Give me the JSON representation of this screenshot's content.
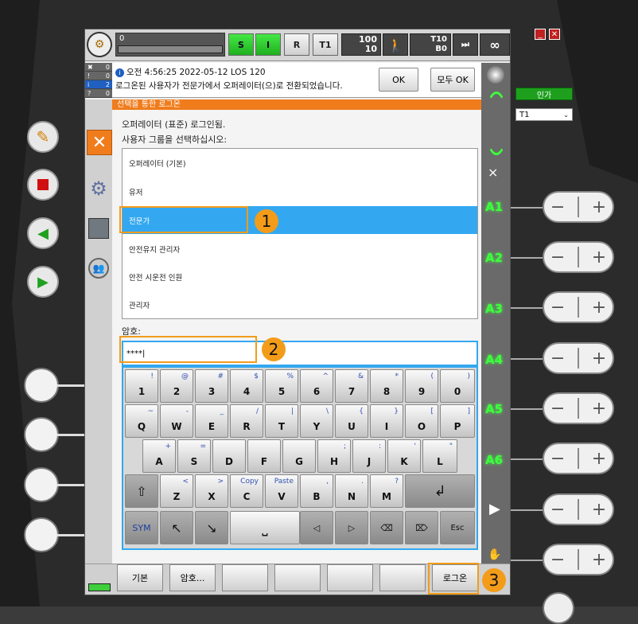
{
  "topbar": {
    "progress_value": "0",
    "btn_s": "S",
    "btn_i": "I",
    "btn_r": "R",
    "btn_t1": "T1",
    "override_top": "100",
    "override_bottom": "10",
    "tool_top": "T10",
    "tool_bottom": "B0",
    "infinity": "∞"
  },
  "message": {
    "counts": [
      "0",
      "0",
      "2",
      "0"
    ],
    "header": "오전 4:56:25 2022-05-12 LOS 120",
    "text": "로그온된 사용자가 전문가에서 오퍼레이터(으)로 전환되었습니다.",
    "ok_label": "OK",
    "all_ok_label": "모두 OK"
  },
  "login": {
    "bar_title": "선택을 통한 로그온",
    "current_user": "오퍼레이터 (표준) 로그인됨.",
    "instruction": "사용자 그룹을 선택하십시오:",
    "groups": [
      "오퍼레이터 (기본)",
      "유저",
      "전문가",
      "안전유지 관리자",
      "안전 시운전 인원",
      "관리자"
    ],
    "password_label": "암호:",
    "password_value": "****|"
  },
  "keyboard": {
    "row1": [
      {
        "k": "1",
        "a": "!"
      },
      {
        "k": "2",
        "a": "@"
      },
      {
        "k": "3",
        "a": "#"
      },
      {
        "k": "4",
        "a": "$"
      },
      {
        "k": "5",
        "a": "%"
      },
      {
        "k": "6",
        "a": "^"
      },
      {
        "k": "7",
        "a": "&"
      },
      {
        "k": "8",
        "a": "*"
      },
      {
        "k": "9",
        "a": "("
      },
      {
        "k": "0",
        "a": ")"
      }
    ],
    "row2": [
      {
        "k": "Q",
        "a": "~"
      },
      {
        "k": "W",
        "a": "-"
      },
      {
        "k": "E",
        "a": "_"
      },
      {
        "k": "R",
        "a": "/"
      },
      {
        "k": "T",
        "a": "|"
      },
      {
        "k": "Y",
        "a": "\\"
      },
      {
        "k": "U",
        "a": "{"
      },
      {
        "k": "I",
        "a": "}"
      },
      {
        "k": "O",
        "a": "["
      },
      {
        "k": "P",
        "a": "]"
      }
    ],
    "row3": [
      {
        "k": "A",
        "a": "+"
      },
      {
        "k": "S",
        "a": "="
      },
      {
        "k": "D",
        "a": ""
      },
      {
        "k": "F",
        "a": ""
      },
      {
        "k": "G",
        "a": ""
      },
      {
        "k": "H",
        "a": ";"
      },
      {
        "k": "J",
        "a": ":"
      },
      {
        "k": "K",
        "a": "'"
      },
      {
        "k": "L",
        "a": "\""
      }
    ],
    "row4": [
      {
        "k": "Z",
        "a": "<"
      },
      {
        "k": "X",
        "a": ">"
      },
      {
        "k": "C",
        "a": "Copy"
      },
      {
        "k": "V",
        "a": "Paste"
      },
      {
        "k": "B",
        "a": ","
      },
      {
        "k": "N",
        "a": "."
      },
      {
        "k": "M",
        "a": "?"
      }
    ],
    "shift": "⇧",
    "enter": "↲",
    "sym": "SYM",
    "arrow_upleft": "↖",
    "arrow_downright": "↘",
    "space": "⎵",
    "left": "◁",
    "right": "▷",
    "backspace": "⌫",
    "delete": "⌦",
    "esc": "Esc"
  },
  "bottombar": {
    "default_label": "기본",
    "password_label": "암호...",
    "logon_label": "로그온"
  },
  "right": {
    "approve_label": "인가",
    "mode_select": "T1",
    "axes": [
      "A1",
      "A2",
      "A3",
      "A4",
      "A5",
      "A6"
    ]
  },
  "annotations": [
    "1",
    "2",
    "3"
  ],
  "colors": {
    "accent": "#f07c1c",
    "selection": "#33a8f0",
    "badge": "#f39c1a",
    "axis_green": "#3dff3d"
  }
}
